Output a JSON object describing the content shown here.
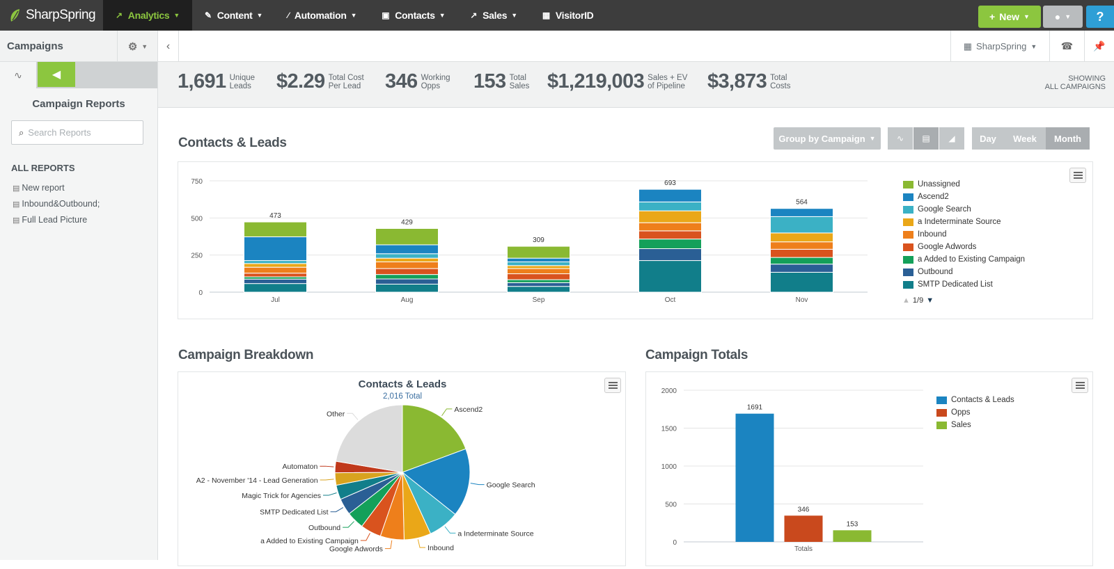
{
  "brand": "SharpSpring",
  "nav": {
    "items": [
      {
        "label": "Analytics",
        "icon": "analytics-icon"
      },
      {
        "label": "Content",
        "icon": "pencil-icon"
      },
      {
        "label": "Automation",
        "icon": "wand-icon"
      },
      {
        "label": "Contacts",
        "icon": "contact-card-icon"
      },
      {
        "label": "Sales",
        "icon": "trend-icon"
      },
      {
        "label": "VisitorID",
        "icon": "building-icon"
      }
    ],
    "new_label": "New",
    "help_label": "?"
  },
  "sidebar": {
    "header": "Campaigns",
    "title": "Campaign Reports",
    "search_placeholder": "Search Reports",
    "section": "ALL REPORTS",
    "reports": [
      "New report",
      "Inbound&Outbound;",
      "Full Lead Picture"
    ]
  },
  "subbar": {
    "account": "SharpSpring"
  },
  "stats": [
    {
      "value": "1,691",
      "label1": "Unique",
      "label2": "Leads"
    },
    {
      "value": "$2.29",
      "label1": "Total Cost",
      "label2": "Per Lead"
    },
    {
      "value": "346",
      "label1": "Working",
      "label2": "Opps"
    },
    {
      "value": "153",
      "label1": "Total",
      "label2": "Sales"
    },
    {
      "value": "$1,219,003",
      "label1": "Sales + EV",
      "label2": "of Pipeline"
    },
    {
      "value": "$3,873",
      "label1": "Total",
      "label2": "Costs"
    }
  ],
  "showing": {
    "line1": "SHOWING",
    "line2": "ALL CAMPAIGNS"
  },
  "contacts_section": {
    "title": "Contacts & Leads",
    "group_label": "Group by Campaign",
    "periods": [
      "Day",
      "Week",
      "Month"
    ],
    "selected_period": "Month",
    "pager": "1/9"
  },
  "breakdown_section": {
    "title": "Campaign Breakdown"
  },
  "totals_section": {
    "title": "Campaign Totals"
  },
  "colors": {
    "unassigned": "#8ab932",
    "ascend2": "#1b84c1",
    "google_search": "#3bb1c5",
    "indeterminate": "#eaa718",
    "inbound": "#ee7f1b",
    "google_adwords": "#d9531e",
    "added_existing": "#14a05a",
    "outbound": "#2a5f95",
    "smtp": "#117e8a"
  },
  "chart_data": [
    {
      "type": "bar",
      "stacked": true,
      "title": "",
      "categories": [
        "Jul",
        "Aug",
        "Sep",
        "Oct",
        "Nov"
      ],
      "totals": [
        473,
        429,
        309,
        693,
        564
      ],
      "ylim": [
        0,
        750
      ],
      "yticks": [
        0,
        250,
        500,
        750
      ],
      "series": [
        {
          "name": "Unassigned",
          "color": "#8ab932",
          "values": [
            100,
            110,
            80,
            0,
            0
          ]
        },
        {
          "name": "Ascend2",
          "color": "#1b84c1",
          "values": [
            160,
            60,
            25,
            85,
            55
          ]
        },
        {
          "name": "Google Search",
          "color": "#3bb1c5",
          "values": [
            20,
            30,
            25,
            60,
            110
          ]
        },
        {
          "name": "a Indeterminate Source",
          "color": "#eaa718",
          "values": [
            25,
            25,
            20,
            80,
            60
          ]
        },
        {
          "name": "Inbound",
          "color": "#ee7f1b",
          "values": [
            40,
            45,
            35,
            55,
            50
          ]
        },
        {
          "name": "Google Adwords",
          "color": "#d9531e",
          "values": [
            25,
            40,
            40,
            55,
            55
          ]
        },
        {
          "name": "a Added to Existing Campaign",
          "color": "#14a05a",
          "values": [
            15,
            30,
            20,
            65,
            45
          ]
        },
        {
          "name": "Outbound",
          "color": "#2a5f95",
          "values": [
            30,
            35,
            25,
            80,
            55
          ]
        },
        {
          "name": "SMTP Dedicated List",
          "color": "#117e8a",
          "values": [
            58,
            54,
            39,
            213,
            134
          ]
        }
      ]
    },
    {
      "type": "pie",
      "title": "Contacts & Leads",
      "subtitle": "2,016 Total",
      "slices": [
        {
          "label": "Ascend2",
          "value": 390,
          "color": "#8ab932"
        },
        {
          "label": "Google Search",
          "value": 330,
          "color": "#1b84c1"
        },
        {
          "label": "a Indeterminate Source",
          "value": 150,
          "color": "#3bb1c5"
        },
        {
          "label": "Inbound",
          "value": 130,
          "color": "#eaa718"
        },
        {
          "label": "Google Adwords",
          "value": 115,
          "color": "#ee7f1b"
        },
        {
          "label": "a Added to Existing Campaign",
          "value": 100,
          "color": "#d9531e"
        },
        {
          "label": "Outbound",
          "value": 85,
          "color": "#14a05a"
        },
        {
          "label": "SMTP Dedicated List",
          "value": 80,
          "color": "#2a5f95"
        },
        {
          "label": "Magic Trick for Agencies",
          "value": 70,
          "color": "#117e8a"
        },
        {
          "label": "A2 - November '14 - Lead Generation",
          "value": 60,
          "color": "#d8a31f"
        },
        {
          "label": "Automaton",
          "value": 55,
          "color": "#c0391b"
        },
        {
          "label": "Other",
          "value": 451,
          "color": "#dcdcdc"
        }
      ]
    },
    {
      "type": "bar",
      "title": "",
      "categories": [
        "Totals"
      ],
      "series": [
        {
          "name": "Contacts & Leads",
          "color": "#1b84c1",
          "values": [
            1691
          ]
        },
        {
          "name": "Opps",
          "color": "#c9491d",
          "values": [
            346
          ]
        },
        {
          "name": "Sales",
          "color": "#8ab932",
          "values": [
            153
          ]
        }
      ],
      "ylim": [
        0,
        2000
      ],
      "yticks": [
        0,
        500,
        1000,
        1500,
        2000
      ]
    }
  ]
}
